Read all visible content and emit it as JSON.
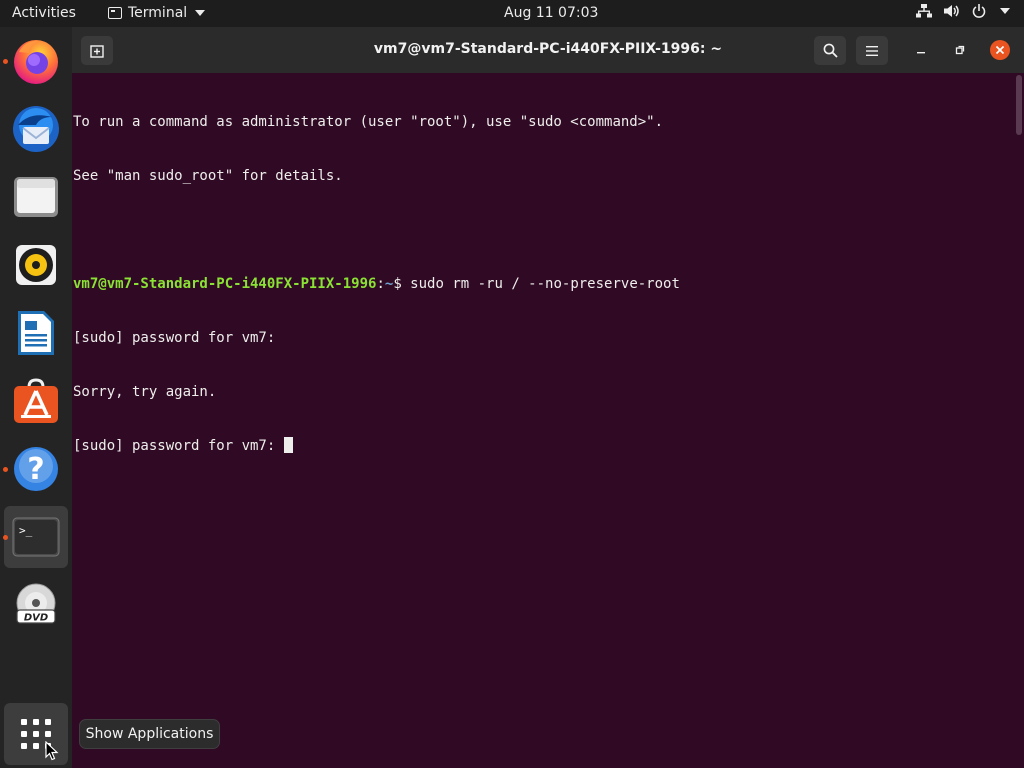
{
  "topbar": {
    "activities": "Activities",
    "app_name": "Terminal",
    "clock": "Aug 11  07:03"
  },
  "dock": {
    "items": [
      {
        "name": "Firefox",
        "running": true
      },
      {
        "name": "Thunderbird",
        "running": false
      },
      {
        "name": "Files",
        "running": false
      },
      {
        "name": "Rhythmbox",
        "running": false
      },
      {
        "name": "LibreOffice Writer",
        "running": false
      },
      {
        "name": "Ubuntu Software",
        "running": false
      },
      {
        "name": "Help",
        "running": true
      },
      {
        "name": "Terminal",
        "running": true,
        "active": true
      },
      {
        "name": "DVD",
        "running": false
      }
    ],
    "show_apps_tooltip": "Show Applications"
  },
  "window": {
    "title": "vm7@vm7-Standard-PC-i440FX-PIIX-1996: ~"
  },
  "terminal": {
    "line1": "To run a command as administrator (user \"root\"), use \"sudo <command>\".",
    "line2": "See \"man sudo_root\" for details.",
    "prompt_user": "vm7@vm7-Standard-PC-i440FX-PIIX-1996",
    "prompt_colon": ":",
    "prompt_path": "~",
    "prompt_symbol": "$ ",
    "command": "sudo rm -ru / --no-preserve-root",
    "line4": "[sudo] password for vm7:",
    "line5": "Sorry, try again.",
    "line6": "[sudo] password for vm7: "
  },
  "colors": {
    "terminal_bg": "#300a24",
    "prompt_user": "#8ae234",
    "prompt_path": "#729fcf",
    "accent": "#e95420"
  }
}
